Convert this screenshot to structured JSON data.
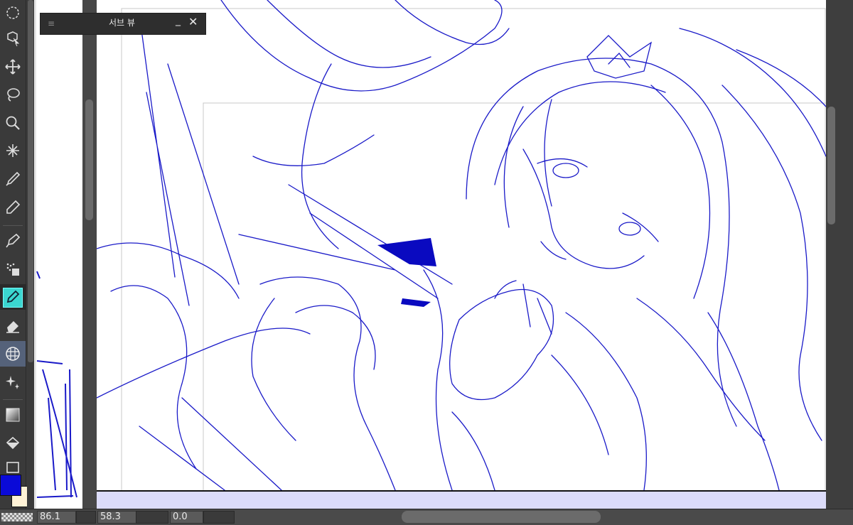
{
  "subview": {
    "title": "서브 뷰",
    "menu_icon": "≡",
    "minimize": "_",
    "close": "✕"
  },
  "statusbar": {
    "zoom": "86.1",
    "angle": "58.3",
    "rotate": "0.0"
  },
  "colors": {
    "main": "#0a0ad8",
    "sub": "#fff2d6",
    "line": "#1a1ac8"
  },
  "tools": [
    "rotate-icon",
    "object-select-icon",
    "move-icon",
    "lasso-icon",
    "zoom-icon",
    "magic-wand-icon",
    "eyedropper-icon",
    "pen-icon",
    "fountain-pen-icon",
    "airbrush-icon",
    "brush-active-icon",
    "eraser-icon",
    "ruler-grid-icon",
    "sparkle-icon",
    "gradient-icon",
    "fill-bucket-icon",
    "rectangle-icon"
  ]
}
